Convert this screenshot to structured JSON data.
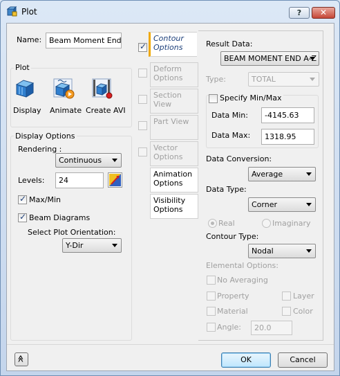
{
  "window": {
    "title": "Plot",
    "help_label": "?",
    "close_label": "✕"
  },
  "left": {
    "name_label": "Name:",
    "name_value": "Beam Moment End A",
    "plot_group": "Plot",
    "plot_buttons": [
      {
        "label": "Display",
        "icon": "display-icon"
      },
      {
        "label": "Animate",
        "icon": "animate-icon"
      },
      {
        "label": "Create AVI",
        "icon": "create-avi-icon"
      }
    ],
    "display_options_group": "Display Options",
    "rendering_label": "Rendering :",
    "rendering_value": "Continuous",
    "levels_label": "Levels:",
    "levels_value": "24",
    "max_min_label": "Max/Min",
    "max_min_checked": true,
    "beam_diagrams_label": "Beam Diagrams",
    "beam_diagrams_checked": true,
    "plot_orientation_label": "Select Plot Orientation:",
    "plot_orientation_value": "Y-Dir"
  },
  "tabs": [
    {
      "label": "Contour Options",
      "checked": true,
      "has_checkbox": true,
      "state": "active"
    },
    {
      "label": "Deform Options",
      "checked": false,
      "has_checkbox": true,
      "state": "disabled"
    },
    {
      "label": "Section View",
      "checked": false,
      "has_checkbox": true,
      "state": "disabled"
    },
    {
      "label": "Part View",
      "checked": false,
      "has_checkbox": true,
      "state": "disabled"
    },
    {
      "label": "Vector Options",
      "checked": false,
      "has_checkbox": true,
      "state": "disabled"
    },
    {
      "label": "Animation Options",
      "has_checkbox": false,
      "state": "enabled"
    },
    {
      "label": "Visibility Options",
      "has_checkbox": false,
      "state": "enabled"
    }
  ],
  "contour": {
    "result_data_label": "Result Data:",
    "result_data_value": "BEAM MOMENT END A-Z",
    "type_label": "Type:",
    "type_value": "TOTAL",
    "specify_minmax_label": "Specify Min/Max",
    "data_min_label": "Data Min:",
    "data_min_value": "-4145.63",
    "data_max_label": "Data Max:",
    "data_max_value": "1318.95",
    "data_conversion_label": "Data Conversion:",
    "data_conversion_value": "Average",
    "data_type_label": "Data Type:",
    "data_type_value": "Corner",
    "real_label": "Real",
    "imaginary_label": "Imaginary",
    "contour_type_label": "Contour Type:",
    "contour_type_value": "Nodal",
    "elemental_options_label": "Elemental Options:",
    "no_averaging_label": "No Averaging",
    "property_label": "Property",
    "layer_label": "Layer",
    "material_label": "Material",
    "color_label": "Color",
    "angle_label": "Angle:",
    "angle_value": "20.0"
  },
  "footer": {
    "expand_label": "≫",
    "ok_label": "OK",
    "cancel_label": "Cancel"
  }
}
